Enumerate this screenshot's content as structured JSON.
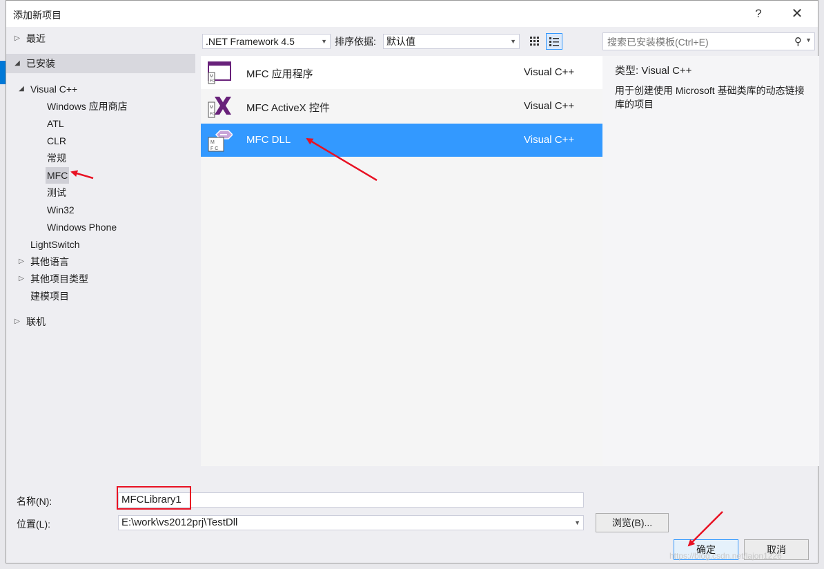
{
  "window": {
    "title": "添加新项目",
    "help_label": "?",
    "close_label": "✕"
  },
  "tree": {
    "recent": "最近",
    "installed": "已安装",
    "visual_cpp": "Visual C++",
    "vc_children": [
      "Windows 应用商店",
      "ATL",
      "CLR",
      "常规",
      "MFC",
      "测试",
      "Win32",
      "Windows Phone"
    ],
    "lightswitch": "LightSwitch",
    "other_languages": "其他语言",
    "other_project_types": "其他项目类型",
    "modeling_projects": "建模项目",
    "online": "联机"
  },
  "toolbar": {
    "framework": ".NET Framework 4.5",
    "sort_label": "排序依据:",
    "sort_value": "默认值"
  },
  "templates": [
    {
      "name": "MFC 应用程序",
      "lang": "Visual C++",
      "icon": "mfc-application-icon"
    },
    {
      "name": "MFC ActiveX 控件",
      "lang": "Visual C++",
      "icon": "mfc-activex-icon"
    },
    {
      "name": "MFC DLL",
      "lang": "Visual C++",
      "icon": "mfc-dll-icon"
    }
  ],
  "search": {
    "placeholder": "搜索已安装模板(Ctrl+E)"
  },
  "info": {
    "type_label": "类型:",
    "type_value": "Visual C++",
    "description": "用于创建使用 Microsoft 基础类库的动态链接库的项目"
  },
  "form": {
    "name_label": "名称(N):",
    "name_value": "MFCLibrary1",
    "location_label": "位置(L):",
    "location_value": "E:\\work\\vs2012prj\\TestDll",
    "browse_label": "浏览(B)...",
    "ok_label": "确定",
    "cancel_label": "取消"
  },
  "watermark": "https://blog.csdn.net/lajon1226",
  "colors": {
    "selection": "#3399ff",
    "annotation_red": "#e81123",
    "mfc_purple": "#68217a"
  }
}
